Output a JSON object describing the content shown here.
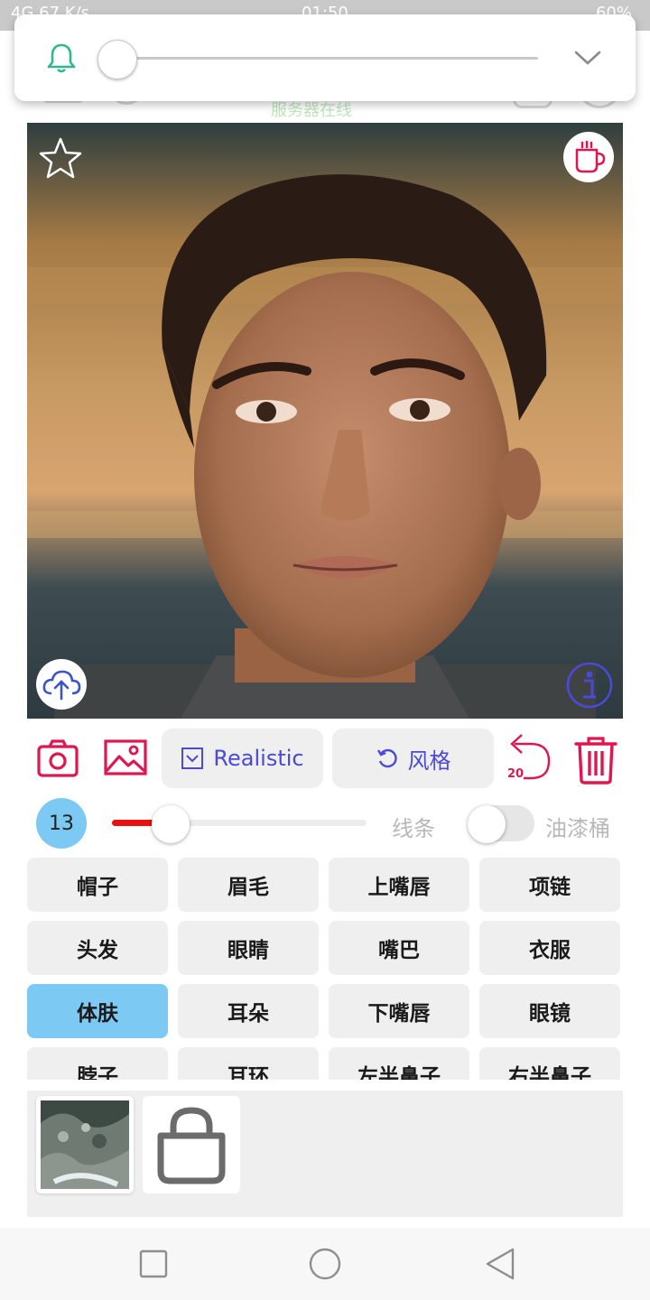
{
  "status_bar": {
    "left_text": "4G 67 K/s",
    "time": "01:50",
    "battery": "60%"
  },
  "app_bar": {
    "status_text": "服务器在线"
  },
  "notification": {
    "icon": "bell-icon",
    "slider_value": 0,
    "expand_icon": "chevron-down-icon"
  },
  "photo": {
    "favorite_icon": "star-outline-icon",
    "coffee_icon": "coffee-cup-icon",
    "upload_icon": "cloud-upload-icon",
    "info_icon": "info-icon"
  },
  "toolbar": {
    "camera_icon": "camera-icon",
    "gallery_icon": "image-icon",
    "style_label": "Realistic",
    "fengge_label": "风格",
    "undo_count": "20",
    "trash_icon": "trash-icon"
  },
  "brush": {
    "size": "13",
    "slider_fraction": 0.23,
    "line_label": "线条",
    "bucket_enabled": false,
    "bucket_label": "油漆桶"
  },
  "categories": [
    {
      "label": "帽子",
      "active": false
    },
    {
      "label": "眉毛",
      "active": false
    },
    {
      "label": "上嘴唇",
      "active": false
    },
    {
      "label": "项链",
      "active": false
    },
    {
      "label": "头发",
      "active": false
    },
    {
      "label": "眼睛",
      "active": false
    },
    {
      "label": "嘴巴",
      "active": false
    },
    {
      "label": "衣服",
      "active": false
    },
    {
      "label": "体肤",
      "active": true
    },
    {
      "label": "耳朵",
      "active": false
    },
    {
      "label": "下嘴唇",
      "active": false
    },
    {
      "label": "眼镜",
      "active": false
    },
    {
      "label": "脖子",
      "active": false
    },
    {
      "label": "耳环",
      "active": false
    },
    {
      "label": "左半鼻子",
      "active": false
    },
    {
      "label": "右半鼻子",
      "active": false
    }
  ],
  "tray": {
    "shop_icon": "shopping-bag-icon"
  },
  "colors": {
    "accent_pink": "#e0164f",
    "accent_blue": "#4a4ad6",
    "active_cell": "#7ccaf3",
    "bell_green": "#2fb88a"
  }
}
